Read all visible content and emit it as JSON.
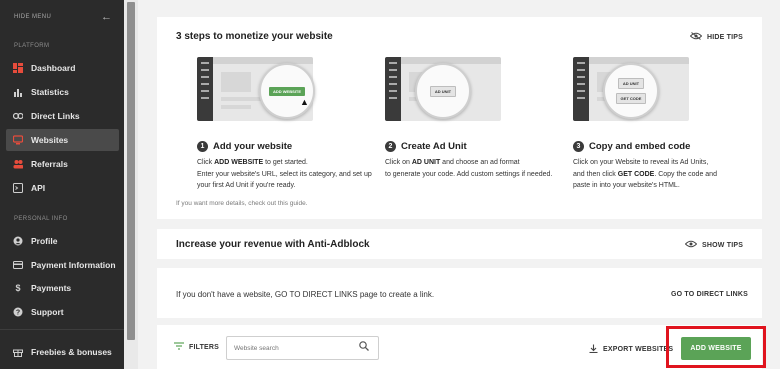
{
  "sidebar": {
    "hide_menu": "HIDE MENU",
    "platform_label": "PLATFORM",
    "personal_label": "PERSONAL INFO",
    "platform_items": [
      {
        "label": "Dashboard",
        "icon": "dashboard-icon"
      },
      {
        "label": "Statistics",
        "icon": "bar-chart-icon"
      },
      {
        "label": "Direct Links",
        "icon": "link-icon"
      },
      {
        "label": "Websites",
        "icon": "monitor-icon",
        "active": true
      },
      {
        "label": "Referrals",
        "icon": "people-icon"
      },
      {
        "label": "API",
        "icon": "terminal-icon"
      }
    ],
    "personal_items": [
      {
        "label": "Profile",
        "icon": "user-icon"
      },
      {
        "label": "Payment Information",
        "icon": "card-icon"
      },
      {
        "label": "Payments",
        "icon": "dollar-icon"
      },
      {
        "label": "Support",
        "icon": "help-icon"
      }
    ],
    "bottom_item": {
      "label": "Freebies & bonuses",
      "icon": "gift-icon"
    }
  },
  "tips": {
    "title": "3 steps to monetize your website",
    "hide_tips": "HIDE TIPS",
    "steps": [
      {
        "number": "1",
        "title": "Add your website",
        "lens_label": "ADD WEBSITE",
        "line1_prefix": "Click ",
        "line1_bold": "ADD WEBSITE",
        "line1_suffix": " to get started.",
        "rest": "Enter your website's URL, select its category, and set up your first Ad Unit if you're ready."
      },
      {
        "number": "2",
        "title": "Create Ad Unit",
        "lens_label": "AD UNIT",
        "line1_prefix": "Click on ",
        "line1_bold": "AD UNIT",
        "line1_suffix": " and choose an ad format",
        "rest": "to generate your code. Add custom settings if needed."
      },
      {
        "number": "3",
        "title": "Copy and embed code",
        "lens_label": "AD UNIT",
        "lens_label2": "GET CODE",
        "line1_prefix": "Click on your Website to reveal its Ad Units,",
        "line2_prefix": "and then click ",
        "line2_bold": "GET CODE",
        "line2_suffix": ". Copy the code and",
        "rest": "paste in into your website's HTML."
      }
    ],
    "details": "If you want more details, check out this guide."
  },
  "adblock": {
    "title": "Increase your revenue with Anti-Adblock",
    "show_tips": "SHOW TIPS"
  },
  "direct_links": {
    "text": "If you don't have a website, GO TO DIRECT LINKS page to create a link.",
    "action": "GO TO DIRECT LINKS"
  },
  "toolbar": {
    "filters": "FILTERS",
    "search_placeholder": "Website search",
    "export": "EXPORT WEBSITES",
    "add_website": "ADD WEBSITE"
  },
  "colors": {
    "accent_green": "#5ba357",
    "sidebar_bg": "#2b2b2b",
    "highlight_red": "#e0141e"
  }
}
